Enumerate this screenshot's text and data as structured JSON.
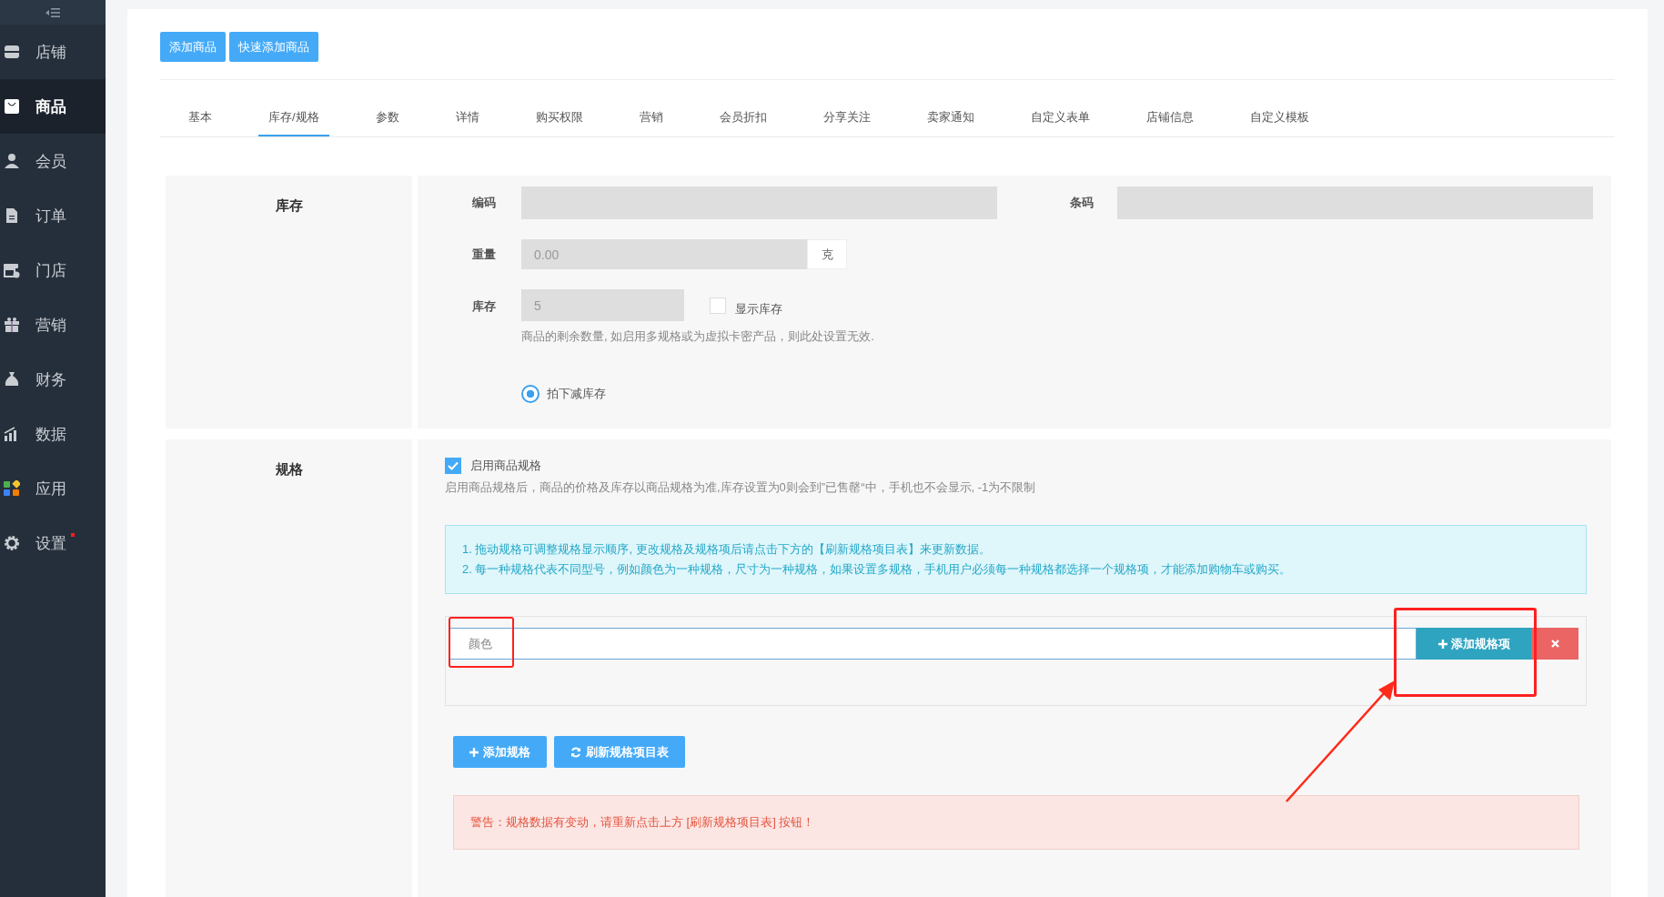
{
  "sidebar": {
    "items": [
      {
        "label": "店铺",
        "selected": false,
        "notify": false
      },
      {
        "label": "商品",
        "selected": true,
        "notify": false
      },
      {
        "label": "会员",
        "selected": false,
        "notify": false
      },
      {
        "label": "订单",
        "selected": false,
        "notify": false
      },
      {
        "label": "门店",
        "selected": false,
        "notify": false
      },
      {
        "label": "营销",
        "selected": false,
        "notify": false
      },
      {
        "label": "财务",
        "selected": false,
        "notify": false
      },
      {
        "label": "数据",
        "selected": false,
        "notify": false
      },
      {
        "label": "应用",
        "selected": false,
        "notify": false
      },
      {
        "label": "设置",
        "selected": false,
        "notify": true
      }
    ]
  },
  "toolbar": {
    "buttons": [
      "添加商品",
      "快速添加商品"
    ]
  },
  "tabs": [
    {
      "label": "基本",
      "selected": false
    },
    {
      "label": "库存/规格",
      "selected": true
    },
    {
      "label": "参数",
      "selected": false
    },
    {
      "label": "详情",
      "selected": false
    },
    {
      "label": "购买权限",
      "selected": false
    },
    {
      "label": "营销",
      "selected": false
    },
    {
      "label": "会员折扣",
      "selected": false
    },
    {
      "label": "分享关注",
      "selected": false
    },
    {
      "label": "卖家通知",
      "selected": false
    },
    {
      "label": "自定义表单",
      "selected": false
    },
    {
      "label": "店铺信息",
      "selected": false
    },
    {
      "label": "自定义模板",
      "selected": false
    }
  ],
  "stock": {
    "title": "库存",
    "code": {
      "label": "编码"
    },
    "barcode": {
      "label": "条码"
    },
    "weight": {
      "label": "重量",
      "value": "0.00",
      "unit": "克"
    },
    "quantity": {
      "label": "库存",
      "value": "5"
    },
    "show_stock": {
      "label": "显示库存",
      "checked": false
    },
    "help": "商品的剩余数量, 如启用多规格或为虚拟卡密产品，则此处设置无效.",
    "deduct": {
      "label": "拍下减库存",
      "selected": true
    }
  },
  "spec": {
    "title": "规格",
    "enable": {
      "label": "启用商品规格",
      "checked": true
    },
    "help": "启用商品规格后，商品的价格及库存以商品规格为准,库存设置为0则会到”已售罄“中，手机也不会显示, -1为不限制",
    "notes": [
      "1. 拖动规格可调整规格显示顺序, 更改规格及规格项后请点击下方的【刷新规格项目表】来更新数据。",
      "2. 每一种规格代表不同型号，例如颜色为一种规格，尺寸为一种规格，如果设置多规格，手机用户必须每一种规格都选择一个规格项，才能添加购物车或购买。"
    ],
    "items": [
      {
        "value": "颜色",
        "add_label": "添加规格项"
      }
    ],
    "add_spec": "添加规格",
    "refresh": "刷新规格项目表",
    "warning": "警告：规格数据有变动，请重新点击上方 [刷新规格项目表] 按钮！"
  }
}
